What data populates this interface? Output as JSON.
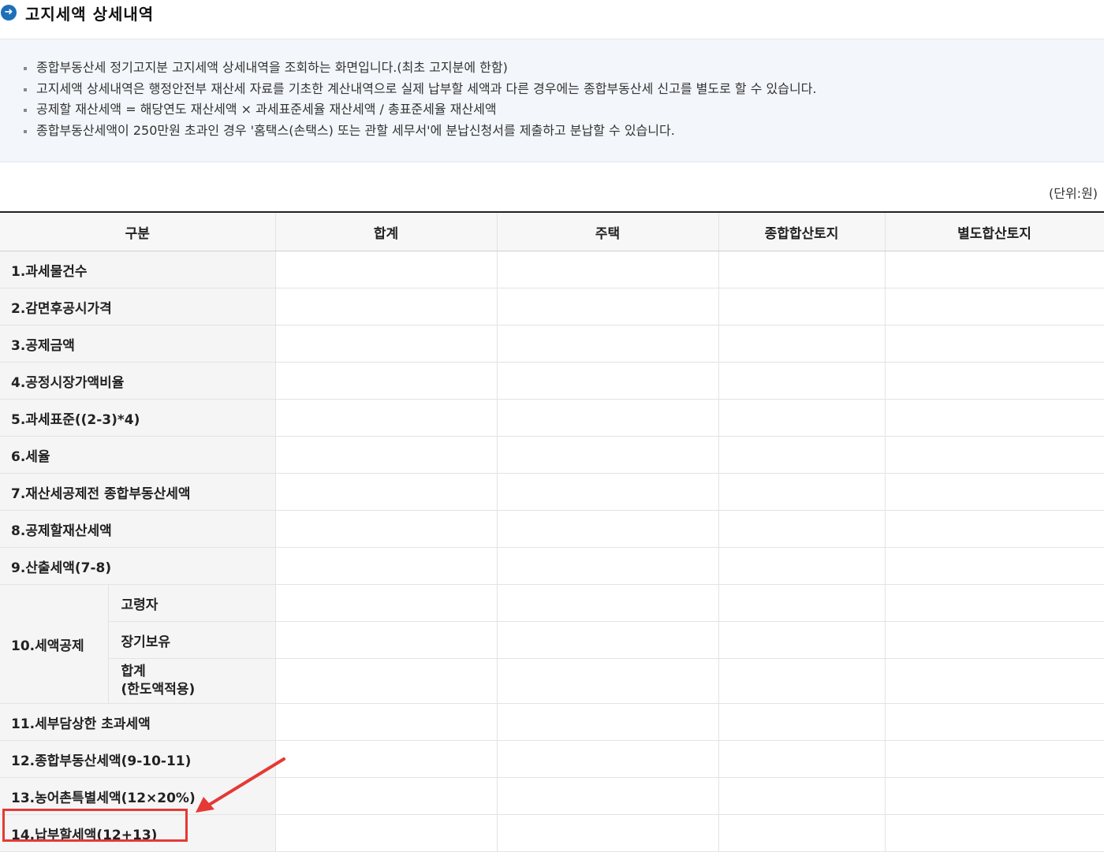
{
  "header": {
    "title": "고지세액 상세내역",
    "icon": "arrow-right-circle-icon"
  },
  "notice": {
    "items": [
      "종합부동산세 정기고지분 고지세액 상세내역을 조회하는 화면입니다.(최초 고지분에 한함)",
      "고지세액 상세내역은 행정안전부 재산세 자료를 기초한 계산내역으로 실제 납부할 세액과 다른 경우에는 종합부동산세 신고를 별도로 할 수 있습니다.",
      "공제할 재산세액 = 해당연도 재산세액 × 과세표준세율 재산세액 / 총표준세율 재산세액",
      "종합부동산세액이 250만원 초과인 경우 '홈택스(손택스) 또는 관할 세무서'에 분납신청서를 제출하고 분납할 수 있습니다."
    ]
  },
  "unit_label": "(단위:원)",
  "table": {
    "headers": [
      "구분",
      "합계",
      "주택",
      "종합합산토지",
      "별도합산토지"
    ],
    "rows": [
      "1.과세물건수",
      "2.감면후공시가격",
      "3.공제금액",
      "4.공정시장가액비율",
      "5.과세표준((2-3)*4)",
      "6.세율",
      "7.재산세공제전 종합부동산세액",
      "8.공제할재산세액",
      "9.산출세액(7-8)"
    ],
    "row10": {
      "label": "10.세액공제",
      "sub": [
        "고령자",
        "장기보유"
      ],
      "sub_total_line1": "합계",
      "sub_total_line2": "(한도액적용)"
    },
    "rows_after": [
      "11.세부담상한 초과세액",
      "12.종합부동산세액(9-10-11)",
      "13.농어촌특별세액(12×20%)",
      "14.납부할세액(12+13)"
    ]
  },
  "annotation": {
    "color": "#e53935"
  }
}
